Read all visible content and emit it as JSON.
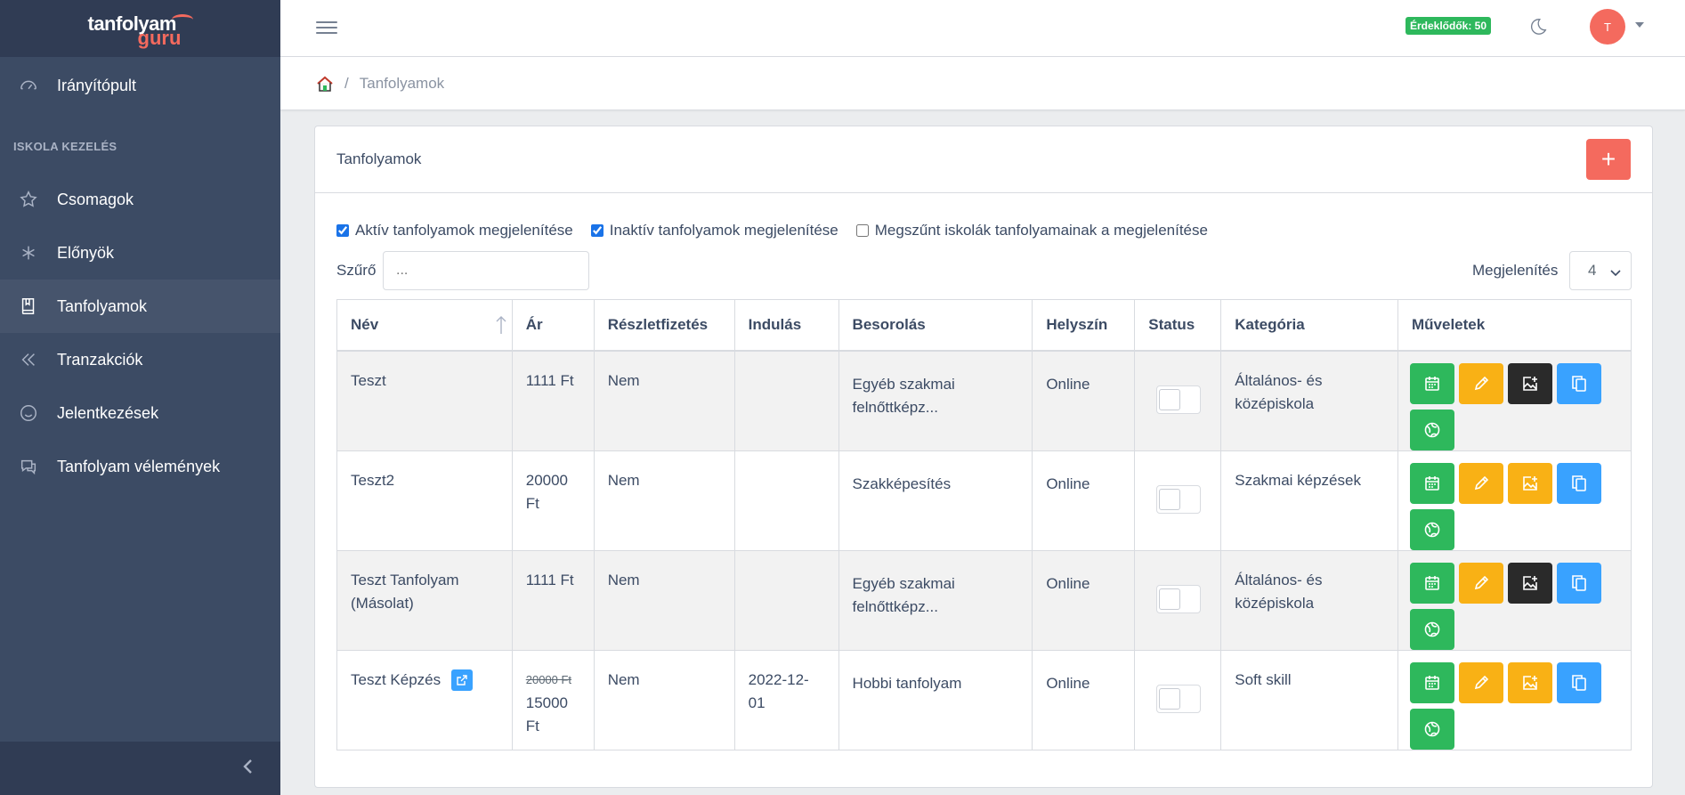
{
  "brand": {
    "name_part1": "tanfolyam",
    "name_part2": "guru"
  },
  "sidebar": {
    "items_top": [
      {
        "label": "Irányítópult",
        "icon": "speedometer-icon"
      }
    ],
    "section_title": "ISKOLA KEZELÉS",
    "items": [
      {
        "label": "Csomagok",
        "icon": "star-icon"
      },
      {
        "label": "Előnyök",
        "icon": "asterisk-icon"
      },
      {
        "label": "Tanfolyamok",
        "icon": "book-icon",
        "active": true
      },
      {
        "label": "Tranzakciók",
        "icon": "double-chevron-left-icon"
      },
      {
        "label": "Jelentkezések",
        "icon": "smile-icon"
      },
      {
        "label": "Tanfolyam vélemények",
        "icon": "chat-icon"
      }
    ]
  },
  "header": {
    "leads_badge": "Érdeklődők: 50",
    "avatar_initial": "T"
  },
  "breadcrumb": {
    "current": "Tanfolyamok"
  },
  "card": {
    "title": "Tanfolyamok",
    "add_label": "+",
    "checkboxes": [
      {
        "label": "Aktív tanfolyamok megjelenítése",
        "checked": true
      },
      {
        "label": "Inaktív tanfolyamok megjelenítése",
        "checked": true
      },
      {
        "label": "Megszűnt iskolák tanfolyamainak a megjelenítése",
        "checked": false
      }
    ],
    "filter_label": "Szűrő",
    "filter_placeholder": "...",
    "show_label": "Megjelenítés",
    "show_value": "4"
  },
  "table": {
    "columns": [
      "Név",
      "Ár",
      "Részletfizetés",
      "Indulás",
      "Besorolás",
      "Helyszín",
      "Status",
      "Kategória",
      "Műveletek"
    ],
    "rows": [
      {
        "name": "Teszt",
        "price": "1111 Ft",
        "old_price": "",
        "installment": "Nem",
        "start": "",
        "classification": "Egyéb szakmai felnőttképz...",
        "location": "Online",
        "category": "Általános- és középiskola",
        "image_btn": "dark",
        "external_link": false
      },
      {
        "name": "Teszt2",
        "price": "20000 Ft",
        "old_price": "",
        "installment": "Nem",
        "start": "",
        "classification": "Szakképesítés",
        "location": "Online",
        "category": "Szakmai képzések",
        "image_btn": "yellow",
        "external_link": false
      },
      {
        "name": "Teszt Tanfolyam (Másolat)",
        "price": "1111 Ft",
        "old_price": "",
        "installment": "Nem",
        "start": "",
        "classification": "Egyéb szakmai felnőttképz...",
        "location": "Online",
        "category": "Általános- és középiskola",
        "image_btn": "dark",
        "external_link": false
      },
      {
        "name": "Teszt Képzés",
        "price": "15000 Ft",
        "old_price": "20000 Ft",
        "installment": "Nem",
        "start": "2022-12-01",
        "classification": "Hobbi tanfolyam",
        "location": "Online",
        "category": "Soft skill",
        "image_btn": "yellow",
        "external_link": true
      }
    ]
  }
}
